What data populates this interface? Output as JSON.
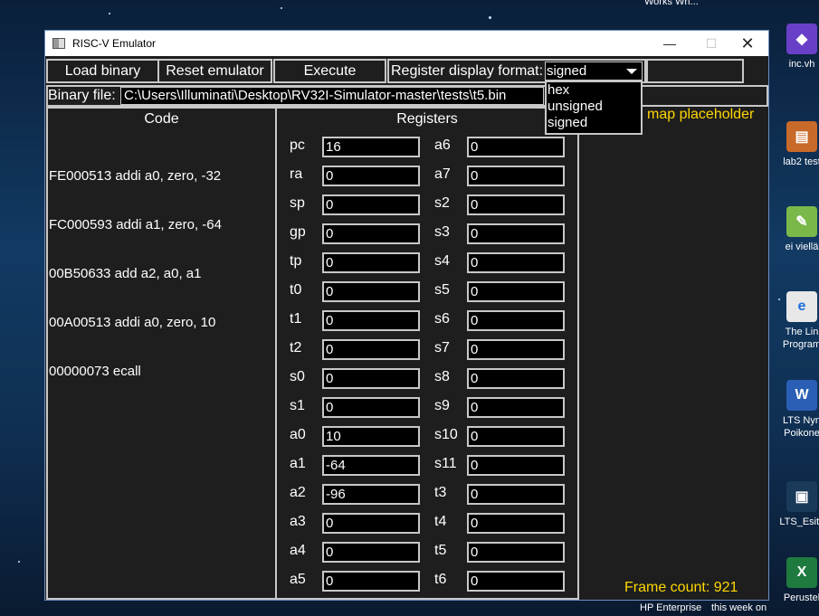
{
  "desktop": {
    "top_label": "Works Wh...",
    "icons": [
      {
        "label1": "inc.vh",
        "label2": ""
      },
      {
        "label1": "lab2 test",
        "label2": ""
      },
      {
        "label1": "ei viellä",
        "label2": ""
      },
      {
        "label1": "The Lin",
        "label2": "Program"
      },
      {
        "label1": "LTS Nyn",
        "label2": "Poikone"
      },
      {
        "label1": "LTS_Esity",
        "label2": ""
      },
      {
        "label1": "Perustel",
        "label2": ""
      }
    ],
    "taskbar_left": "HP Enterprise",
    "taskbar_right": "this week on"
  },
  "window": {
    "title": "RISC-V Emulator",
    "minimize": "—",
    "maximize": "☐",
    "close": "✕"
  },
  "toolbar": {
    "load_binary": "Load binary",
    "reset_emulator": "Reset emulator",
    "execute": "Execute",
    "format_label": "Register display format:",
    "format_selected": "signed",
    "format_options": [
      "hex",
      "unsigned",
      "signed"
    ]
  },
  "binary": {
    "label": "Binary file:",
    "path": "C:\\Users\\Illuminati\\Desktop\\RV32I-Simulator-master\\tests\\t5.bin"
  },
  "code": {
    "title": "Code",
    "lines": [
      "FE000513 addi a0, zero, -32",
      "FC000593 addi a1, zero, -64",
      "00B50633 add a2, a0, a1",
      "00A00513 addi a0, zero, 10",
      "00000073 ecall"
    ]
  },
  "registers": {
    "title": "Registers",
    "left": [
      {
        "name": "pc",
        "value": "16"
      },
      {
        "name": "ra",
        "value": "0"
      },
      {
        "name": "sp",
        "value": "0"
      },
      {
        "name": "gp",
        "value": "0"
      },
      {
        "name": "tp",
        "value": "0"
      },
      {
        "name": "t0",
        "value": "0"
      },
      {
        "name": "t1",
        "value": "0"
      },
      {
        "name": "t2",
        "value": "0"
      },
      {
        "name": "s0",
        "value": "0"
      },
      {
        "name": "s1",
        "value": "0"
      },
      {
        "name": "a0",
        "value": "10"
      },
      {
        "name": "a1",
        "value": "-64"
      },
      {
        "name": "a2",
        "value": "-96"
      },
      {
        "name": "a3",
        "value": "0"
      },
      {
        "name": "a4",
        "value": "0"
      },
      {
        "name": "a5",
        "value": "0"
      }
    ],
    "right": [
      {
        "name": "a6",
        "value": "0"
      },
      {
        "name": "a7",
        "value": "0"
      },
      {
        "name": "s2",
        "value": "0"
      },
      {
        "name": "s3",
        "value": "0"
      },
      {
        "name": "s4",
        "value": "0"
      },
      {
        "name": "s5",
        "value": "0"
      },
      {
        "name": "s6",
        "value": "0"
      },
      {
        "name": "s7",
        "value": "0"
      },
      {
        "name": "s8",
        "value": "0"
      },
      {
        "name": "s9",
        "value": "0"
      },
      {
        "name": "s10",
        "value": "0"
      },
      {
        "name": "s11",
        "value": "0"
      },
      {
        "name": "t3",
        "value": "0"
      },
      {
        "name": "t4",
        "value": "0"
      },
      {
        "name": "t5",
        "value": "0"
      },
      {
        "name": "t6",
        "value": "0"
      }
    ]
  },
  "map_placeholder": "map placeholder",
  "frame_count": "Frame count: 921",
  "colors": {
    "accent_yellow": "#ffd700",
    "window_bg": "#1e1e1e",
    "border": "#c8c8c8"
  }
}
